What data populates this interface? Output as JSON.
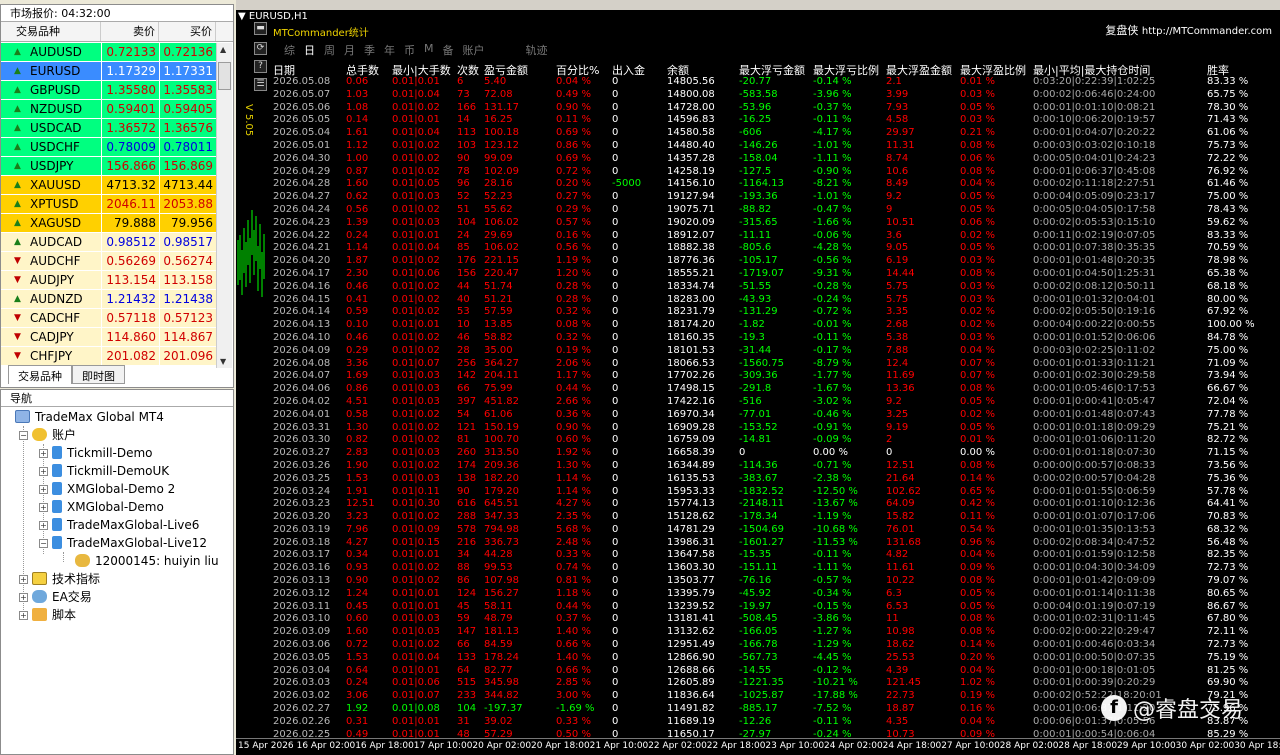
{
  "market": {
    "title": "市场报价: 04:32:00",
    "col_symbol": "交易品种",
    "col_bid": "卖价",
    "col_ask": "买价",
    "rows": [
      {
        "sym": "AUDUSD",
        "bid": "0.72133",
        "ask": "0.72136",
        "dir": "up",
        "bg": "#00ff80",
        "tc": "#d00000"
      },
      {
        "sym": "EURUSD",
        "bid": "1.17329",
        "ask": "1.17331",
        "dir": "up",
        "bg": "#3a8cff",
        "tc": "#ffffff"
      },
      {
        "sym": "GBPUSD",
        "bid": "1.35580",
        "ask": "1.35583",
        "dir": "up",
        "bg": "#00ff80",
        "tc": "#d00000"
      },
      {
        "sym": "NZDUSD",
        "bid": "0.59401",
        "ask": "0.59405",
        "dir": "up",
        "bg": "#00ff80",
        "tc": "#d00000"
      },
      {
        "sym": "USDCAD",
        "bid": "1.36572",
        "ask": "1.36576",
        "dir": "up",
        "bg": "#00ff80",
        "tc": "#d00000"
      },
      {
        "sym": "USDCHF",
        "bid": "0.78009",
        "ask": "0.78011",
        "dir": "up",
        "bg": "#00ff80",
        "tc": "#0000e0"
      },
      {
        "sym": "USDJPY",
        "bid": "156.866",
        "ask": "156.869",
        "dir": "up",
        "bg": "#00ff80",
        "tc": "#d00000"
      },
      {
        "sym": "XAUUSD",
        "bid": "4713.32",
        "ask": "4713.44",
        "dir": "up",
        "bg": "#ffd000",
        "tc": "#000000"
      },
      {
        "sym": "XPTUSD",
        "bid": "2046.11",
        "ask": "2053.88",
        "dir": "up",
        "bg": "#ffd000",
        "tc": "#d00000"
      },
      {
        "sym": "XAGUSD",
        "bid": "79.888",
        "ask": "79.956",
        "dir": "up",
        "bg": "#ffd000",
        "tc": "#000000"
      },
      {
        "sym": "AUDCAD",
        "bid": "0.98512",
        "ask": "0.98517",
        "dir": "up",
        "bg": "#fff5c8",
        "tc": "#0000e0"
      },
      {
        "sym": "AUDCHF",
        "bid": "0.56269",
        "ask": "0.56274",
        "dir": "down",
        "bg": "#fff5c8",
        "tc": "#d00000"
      },
      {
        "sym": "AUDJPY",
        "bid": "113.154",
        "ask": "113.158",
        "dir": "down",
        "bg": "#fff5c8",
        "tc": "#d00000"
      },
      {
        "sym": "AUDNZD",
        "bid": "1.21432",
        "ask": "1.21438",
        "dir": "up",
        "bg": "#fff5c8",
        "tc": "#0000e0"
      },
      {
        "sym": "CADCHF",
        "bid": "0.57118",
        "ask": "0.57123",
        "dir": "down",
        "bg": "#fff5c8",
        "tc": "#d00000"
      },
      {
        "sym": "CADJPY",
        "bid": "114.860",
        "ask": "114.867",
        "dir": "down",
        "bg": "#fff5c8",
        "tc": "#d00000"
      },
      {
        "sym": "CHFJPY",
        "bid": "201.082",
        "ask": "201.096",
        "dir": "down",
        "bg": "#fff5c8",
        "tc": "#d00000"
      }
    ],
    "tab1": "交易品种",
    "tab2": "即时图"
  },
  "navigator": {
    "title": "导航",
    "root": "TradeMax Global MT4",
    "accounts": "账户",
    "items": [
      "Tickmill-Demo",
      "Tickmill-DemoUK",
      "XMGlobal-Demo 2",
      "XMGlobal-Demo",
      "TradeMaxGlobal-Live6",
      "TradeMaxGlobal-Live12"
    ],
    "user": "12000145: huiyin liu",
    "indicators": "技术指标",
    "ea": "EA交易",
    "scripts": "脚本"
  },
  "chart": {
    "title": "EURUSD,H1",
    "panel_title": "MTCommander统计",
    "link_name": "复盘侠",
    "link_url": "http://MTCommander.com",
    "version": "V 5.05",
    "period_tabs": [
      "综",
      "日",
      "周",
      "月",
      "季",
      "年",
      "币",
      "M",
      "备",
      "账户",
      "轨迹"
    ],
    "headers": [
      "日期",
      "总手数",
      "最小|大手数",
      "次数",
      "盈亏金额",
      "百分比%",
      "出入金",
      "余额",
      "最大浮亏金额",
      "最大浮亏比例",
      "最大浮盈金额",
      "最大浮盈比例",
      "最小|平均|最大持仓时间",
      "胜率"
    ],
    "xaxis": [
      "15 Apr 2026",
      "16 Apr 02:00",
      "16 Apr 18:00",
      "17 Apr 10:00",
      "20 Apr 02:00",
      "20 Apr 18:00",
      "21 Apr 10:00",
      "22 Apr 02:00",
      "22 Apr 18:00",
      "23 Apr 10:00",
      "24 Apr 02:00",
      "24 Apr 18:00",
      "27 Apr 10:00",
      "28 Apr 02:00",
      "28 Apr 18:00",
      "29 Apr 10:00",
      "30 Apr 02:00",
      "30 Apr 18:00"
    ],
    "watermark": "@睿盘交易",
    "rows": [
      [
        "2026.05.08",
        "0.06",
        "0.01|0.01",
        "6",
        "5.40",
        "0.04 %",
        "0",
        "14805.56",
        "-20.77",
        "-0.14 %",
        "2.1",
        "0.01 %",
        "0:03:20|0:22:39|1:02:25",
        "83.33 %"
      ],
      [
        "2026.05.07",
        "1.03",
        "0.01|0.04",
        "73",
        "72.08",
        "0.49 %",
        "0",
        "14800.08",
        "-583.58",
        "-3.96 %",
        "3.99",
        "0.03 %",
        "0:00:02|0:06:46|0:24:00",
        "65.75 %"
      ],
      [
        "2026.05.06",
        "1.08",
        "0.01|0.02",
        "166",
        "131.17",
        "0.90 %",
        "0",
        "14728.00",
        "-53.96",
        "-0.37 %",
        "7.93",
        "0.05 %",
        "0:00:01|0:01:10|0:08:21",
        "78.30 %"
      ],
      [
        "2026.05.05",
        "0.14",
        "0.01|0.01",
        "14",
        "16.25",
        "0.11 %",
        "0",
        "14596.83",
        "-16.25",
        "-0.11 %",
        "4.58",
        "0.03 %",
        "0:00:10|0:06:20|0:19:57",
        "71.43 %"
      ],
      [
        "2026.05.04",
        "1.61",
        "0.01|0.04",
        "113",
        "100.18",
        "0.69 %",
        "0",
        "14580.58",
        "-606",
        "-4.17 %",
        "29.97",
        "0.21 %",
        "0:00:01|0:04:07|0:20:22",
        "61.06 %"
      ],
      [
        "2026.05.01",
        "1.12",
        "0.01|0.02",
        "103",
        "123.12",
        "0.86 %",
        "0",
        "14480.40",
        "-146.26",
        "-1.01 %",
        "11.31",
        "0.08 %",
        "0:00:03|0:03:02|0:10:18",
        "75.73 %"
      ],
      [
        "2026.04.30",
        "1.00",
        "0.01|0.02",
        "90",
        "99.09",
        "0.69 %",
        "0",
        "14357.28",
        "-158.04",
        "-1.11 %",
        "8.74",
        "0.06 %",
        "0:00:05|0:04:01|0:24:23",
        "72.22 %"
      ],
      [
        "2026.04.29",
        "0.87",
        "0.01|0.02",
        "78",
        "102.09",
        "0.72 %",
        "0",
        "14258.19",
        "-127.5",
        "-0.90 %",
        "10.6",
        "0.08 %",
        "0:00:01|0:06:37|0:45:08",
        "76.92 %"
      ],
      [
        "2026.04.28",
        "1.60",
        "0.01|0.05",
        "96",
        "28.16",
        "0.20 %",
        "-5000",
        "14156.10",
        "-1164.13",
        "-8.21 %",
        "8.49",
        "0.04 %",
        "0:00:02|0:11:18|2:27:51",
        "61.46 %"
      ],
      [
        "2026.04.27",
        "0.62",
        "0.01|0.03",
        "52",
        "52.23",
        "0.27 %",
        "0",
        "19127.94",
        "-193.36",
        "-1.01 %",
        "9.2",
        "0.05 %",
        "0:00:04|0:05:09|0:23:17",
        "75.00 %"
      ],
      [
        "2026.04.24",
        "0.56",
        "0.01|0.02",
        "51",
        "55.62",
        "0.29 %",
        "0",
        "19075.71",
        "-88.82",
        "-0.47 %",
        "9",
        "0.05 %",
        "0:00:05|0:04:05|0:17:58",
        "78.43 %"
      ],
      [
        "2026.04.23",
        "1.39",
        "0.01|0.03",
        "104",
        "106.02",
        "0.57 %",
        "0",
        "19020.09",
        "-315.65",
        "-1.66 %",
        "10.51",
        "0.06 %",
        "0:00:02|0:05:53|0:15:10",
        "59.62 %"
      ],
      [
        "2026.04.22",
        "0.24",
        "0.01|0.01",
        "24",
        "29.69",
        "0.16 %",
        "0",
        "18912.07",
        "-11.11",
        "-0.06 %",
        "3.6",
        "0.02 %",
        "0:00:11|0:02:19|0:07:05",
        "83.33 %"
      ],
      [
        "2026.04.21",
        "1.14",
        "0.01|0.04",
        "85",
        "106.02",
        "0.56 %",
        "0",
        "18882.38",
        "-805.6",
        "-4.28 %",
        "9.05",
        "0.05 %",
        "0:00:01|0:07:38|0:35:35",
        "70.59 %"
      ],
      [
        "2026.04.20",
        "1.87",
        "0.01|0.02",
        "176",
        "221.15",
        "1.19 %",
        "0",
        "18776.36",
        "-105.17",
        "-0.56 %",
        "6.19",
        "0.03 %",
        "0:00:01|0:01:48|0:20:35",
        "78.98 %"
      ],
      [
        "2026.04.17",
        "2.30",
        "0.01|0.06",
        "156",
        "220.47",
        "1.20 %",
        "0",
        "18555.21",
        "-1719.07",
        "-9.31 %",
        "14.44",
        "0.08 %",
        "0:00:01|0:04:50|1:25:31",
        "65.38 %"
      ],
      [
        "2026.04.16",
        "0.46",
        "0.01|0.02",
        "44",
        "51.74",
        "0.28 %",
        "0",
        "18334.74",
        "-51.55",
        "-0.28 %",
        "5.75",
        "0.03 %",
        "0:00:02|0:08:12|0:50:11",
        "68.18 %"
      ],
      [
        "2026.04.15",
        "0.41",
        "0.01|0.02",
        "40",
        "51.21",
        "0.28 %",
        "0",
        "18283.00",
        "-43.93",
        "-0.24 %",
        "5.75",
        "0.03 %",
        "0:00:01|0:01:32|0:04:01",
        "80.00 %"
      ],
      [
        "2026.04.14",
        "0.59",
        "0.01|0.02",
        "53",
        "57.59",
        "0.32 %",
        "0",
        "18231.79",
        "-131.29",
        "-0.72 %",
        "3.35",
        "0.02 %",
        "0:00:02|0:05:50|0:19:16",
        "67.92 %"
      ],
      [
        "2026.04.13",
        "0.10",
        "0.01|0.01",
        "10",
        "13.85",
        "0.08 %",
        "0",
        "18174.20",
        "-1.82",
        "-0.01 %",
        "2.68",
        "0.02 %",
        "0:00:04|0:00:22|0:00:55",
        "100.00 %"
      ],
      [
        "2026.04.10",
        "0.46",
        "0.01|0.02",
        "46",
        "58.82",
        "0.32 %",
        "0",
        "18160.35",
        "-19.3",
        "-0.11 %",
        "5.38",
        "0.03 %",
        "0:00:01|0:01:52|0:06:06",
        "84.78 %"
      ],
      [
        "2026.04.09",
        "0.29",
        "0.01|0.02",
        "28",
        "35.00",
        "0.19 %",
        "0",
        "18101.53",
        "-31.44",
        "-0.17 %",
        "7.88",
        "0.04 %",
        "0:00:03|0:02:25|0:11:02",
        "75.00 %"
      ],
      [
        "2026.04.08",
        "3.36",
        "0.01|0.07",
        "256",
        "364.27",
        "2.06 %",
        "0",
        "18066.53",
        "-1560.75",
        "-8.79 %",
        "12.4",
        "0.07 %",
        "0:00:01|0:01:33|0:11:21",
        "71.09 %"
      ],
      [
        "2026.04.07",
        "1.69",
        "0.01|0.03",
        "142",
        "204.11",
        "1.17 %",
        "0",
        "17702.26",
        "-309.36",
        "-1.77 %",
        "11.69",
        "0.07 %",
        "0:00:01|0:02:30|0:29:58",
        "73.94 %"
      ],
      [
        "2026.04.06",
        "0.86",
        "0.01|0.03",
        "66",
        "75.99",
        "0.44 %",
        "0",
        "17498.15",
        "-291.8",
        "-1.67 %",
        "13.36",
        "0.08 %",
        "0:00:01|0:05:46|0:17:53",
        "66.67 %"
      ],
      [
        "2026.04.02",
        "4.51",
        "0.01|0.03",
        "397",
        "451.82",
        "2.66 %",
        "0",
        "17422.16",
        "-516",
        "-3.02 %",
        "9.2",
        "0.05 %",
        "0:00:01|0:00:41|0:05:47",
        "72.04 %"
      ],
      [
        "2026.04.01",
        "0.58",
        "0.01|0.02",
        "54",
        "61.06",
        "0.36 %",
        "0",
        "16970.34",
        "-77.01",
        "-0.46 %",
        "3.25",
        "0.02 %",
        "0:00:01|0:01:48|0:07:43",
        "77.78 %"
      ],
      [
        "2026.03.31",
        "1.30",
        "0.01|0.02",
        "121",
        "150.19",
        "0.90 %",
        "0",
        "16909.28",
        "-153.52",
        "-0.91 %",
        "9.19",
        "0.05 %",
        "0:00:01|0:01:18|0:09:29",
        "75.21 %"
      ],
      [
        "2026.03.30",
        "0.82",
        "0.01|0.02",
        "81",
        "100.70",
        "0.60 %",
        "0",
        "16759.09",
        "-14.81",
        "-0.09 %",
        "2",
        "0.01 %",
        "0:00:01|0:01:06|0:11:20",
        "82.72 %"
      ],
      [
        "2026.03.27",
        "2.83",
        "0.01|0.03",
        "260",
        "313.50",
        "1.92 %",
        "0",
        "16658.39",
        "0",
        "0.00 %",
        "0",
        "0.00 %",
        "0:00:01|0:01:18|0:07:30",
        "71.15 %"
      ],
      [
        "2026.03.26",
        "1.90",
        "0.01|0.02",
        "174",
        "209.36",
        "1.30 %",
        "0",
        "16344.89",
        "-114.36",
        "-0.71 %",
        "12.51",
        "0.08 %",
        "0:00:00|0:00:57|0:08:33",
        "73.56 %"
      ],
      [
        "2026.03.25",
        "1.53",
        "0.01|0.03",
        "138",
        "182.20",
        "1.14 %",
        "0",
        "16135.53",
        "-383.67",
        "-2.38 %",
        "21.64",
        "0.14 %",
        "0:00:02|0:00:57|0:04:28",
        "75.36 %"
      ],
      [
        "2026.03.24",
        "1.91",
        "0.01|0.11",
        "90",
        "179.20",
        "1.14 %",
        "0",
        "15953.33",
        "-1832.52",
        "-12.50 %",
        "102.62",
        "0.65 %",
        "0:00:01|0:01:55|0:06:59",
        "57.78 %"
      ],
      [
        "2026.03.23",
        "12.51",
        "0.01|0.30",
        "616",
        "645.51",
        "4.27 %",
        "0",
        "15774.13",
        "-2148.11",
        "-13.67 %",
        "64.09",
        "0.42 %",
        "0:00:01|0:01:10|0:12:36",
        "64.41 %"
      ],
      [
        "2026.03.20",
        "3.23",
        "0.01|0.02",
        "288",
        "347.33",
        "2.35 %",
        "0",
        "15128.62",
        "-178.34",
        "-1.19 %",
        "15.82",
        "0.11 %",
        "0:00:01|0:01:07|0:17:06",
        "70.83 %"
      ],
      [
        "2026.03.19",
        "7.96",
        "0.01|0.09",
        "578",
        "794.98",
        "5.68 %",
        "0",
        "14781.29",
        "-1504.69",
        "-10.68 %",
        "76.01",
        "0.54 %",
        "0:00:01|0:01:35|0:13:53",
        "68.32 %"
      ],
      [
        "2026.03.18",
        "4.27",
        "0.01|0.15",
        "216",
        "336.73",
        "2.48 %",
        "0",
        "13986.31",
        "-1601.27",
        "-11.53 %",
        "131.68",
        "0.96 %",
        "0:00:02|0:08:34|0:47:52",
        "56.48 %"
      ],
      [
        "2026.03.17",
        "0.34",
        "0.01|0.01",
        "34",
        "44.28",
        "0.33 %",
        "0",
        "13647.58",
        "-15.35",
        "-0.11 %",
        "4.82",
        "0.04 %",
        "0:00:01|0:01:59|0:12:58",
        "82.35 %"
      ],
      [
        "2026.03.16",
        "0.93",
        "0.01|0.02",
        "88",
        "99.53",
        "0.74 %",
        "0",
        "13603.30",
        "-151.11",
        "-1.11 %",
        "11.61",
        "0.09 %",
        "0:00:01|0:04:30|0:34:09",
        "72.73 %"
      ],
      [
        "2026.03.13",
        "0.90",
        "0.01|0.02",
        "86",
        "107.98",
        "0.81 %",
        "0",
        "13503.77",
        "-76.16",
        "-0.57 %",
        "10.22",
        "0.08 %",
        "0:00:01|0:01:42|0:09:09",
        "79.07 %"
      ],
      [
        "2026.03.12",
        "1.24",
        "0.01|0.01",
        "124",
        "156.27",
        "1.18 %",
        "0",
        "13395.79",
        "-45.92",
        "-0.34 %",
        "6.3",
        "0.05 %",
        "0:00:01|0:01:14|0:11:38",
        "80.65 %"
      ],
      [
        "2026.03.11",
        "0.45",
        "0.01|0.01",
        "45",
        "58.11",
        "0.44 %",
        "0",
        "13239.52",
        "-19.97",
        "-0.15 %",
        "6.53",
        "0.05 %",
        "0:00:04|0:01:19|0:07:19",
        "86.67 %"
      ],
      [
        "2026.03.10",
        "0.60",
        "0.01|0.03",
        "59",
        "48.79",
        "0.37 %",
        "0",
        "13181.41",
        "-508.45",
        "-3.86 %",
        "11",
        "0.08 %",
        "0:00:01|0:02:31|0:11:45",
        "67.80 %"
      ],
      [
        "2026.03.09",
        "1.60",
        "0.01|0.03",
        "147",
        "181.13",
        "1.40 %",
        "0",
        "13132.62",
        "-166.05",
        "-1.27 %",
        "10.98",
        "0.08 %",
        "0:00:02|0:00:22|0:29:47",
        "72.11 %"
      ],
      [
        "2026.03.06",
        "0.72",
        "0.01|0.02",
        "66",
        "84.59",
        "0.66 %",
        "0",
        "12951.49",
        "-166.78",
        "-1.29 %",
        "18.62",
        "0.14 %",
        "0:00:01|0:00:46|0:03:34",
        "72.73 %"
      ],
      [
        "2026.03.05",
        "1.53",
        "0.01|0.04",
        "133",
        "178.24",
        "1.40 %",
        "0",
        "12866.90",
        "-567.73",
        "-4.45 %",
        "25.53",
        "0.20 %",
        "0:00:01|0:00:50|0:07:35",
        "75.19 %"
      ],
      [
        "2026.03.04",
        "0.64",
        "0.01|0.01",
        "64",
        "82.77",
        "0.66 %",
        "0",
        "12688.66",
        "-14.55",
        "-0.12 %",
        "4.39",
        "0.04 %",
        "0:00:01|0:00:18|0:01:05",
        "81.25 %"
      ],
      [
        "2026.03.03",
        "0.24",
        "0.01|0.06",
        "515",
        "345.98",
        "2.85 %",
        "0",
        "12605.89",
        "-1221.35",
        "-10.21 %",
        "121.45",
        "1.02 %",
        "0:00:01|0:00:39|0:20:29",
        "69.90 %"
      ],
      [
        "2026.03.02",
        "3.06",
        "0.01|0.07",
        "233",
        "344.82",
        "3.00 %",
        "0",
        "11836.64",
        "-1025.87",
        "-17.88 %",
        "22.73",
        "0.19 %",
        "0:00:02|0:52:22|18:20:01",
        "79.21 %"
      ],
      [
        "2026.02.27",
        "1.92",
        "0.01|0.08",
        "104",
        "-197.37",
        "-1.69 %",
        "0",
        "11491.82",
        "-885.17",
        "-7.52 %",
        "18.87",
        "0.16 %",
        "0:00:01|0:06:37|1:11:20",
        "75.96 %"
      ],
      [
        "2026.02.26",
        "0.31",
        "0.01|0.01",
        "31",
        "39.02",
        "0.33 %",
        "0",
        "11689.19",
        "-12.26",
        "-0.11 %",
        "4.35",
        "0.04 %",
        "0:00:06|0:01:37|0:05:56",
        "83.87 %"
      ],
      [
        "2026.02.25",
        "0.49",
        "0.01|0.01",
        "48",
        "57.29",
        "0.50 %",
        "0",
        "11650.17",
        "-27.97",
        "-0.24 %",
        "10.73",
        "0.09 %",
        "0:00:01|0:00:54|0:06:04",
        "85.29 %"
      ]
    ]
  }
}
